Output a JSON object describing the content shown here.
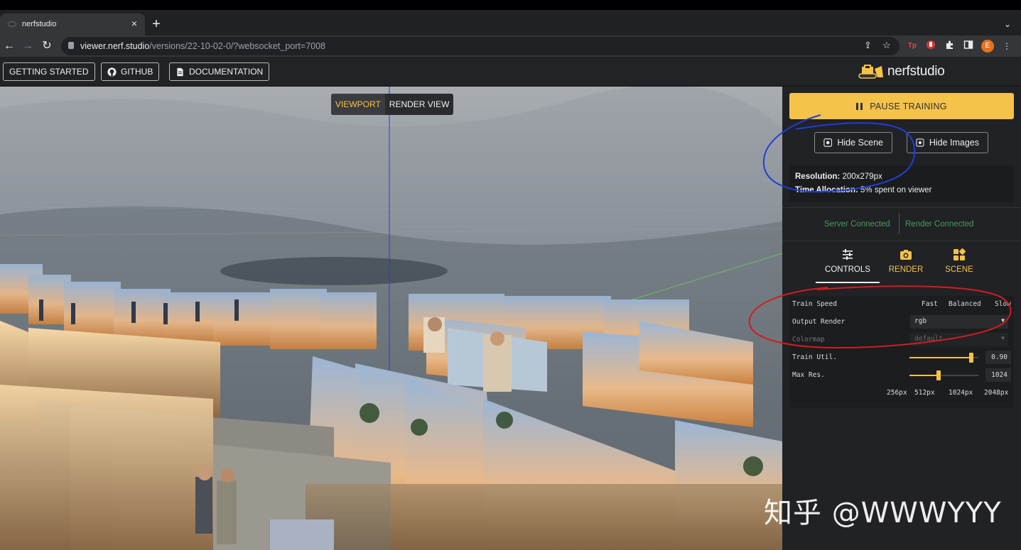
{
  "browser": {
    "tab_title": "nerfstudio",
    "tab_close": "×",
    "new_tab": "+",
    "tab_menu": "⌄",
    "url_host": "viewer.nerf.studio",
    "url_path": "/versions/22-10-02-0/?websocket_port=7008",
    "profile_initial": "E"
  },
  "header": {
    "buttons": [
      {
        "label": "GETTING STARTED"
      },
      {
        "label": "GITHUB"
      },
      {
        "label": "DOCUMENTATION"
      }
    ],
    "logo_text": "nerfstudio"
  },
  "viewport": {
    "tabs": [
      "VIEWPORT",
      "RENDER VIEW"
    ]
  },
  "panel": {
    "pause_label": "PAUSE TRAINING",
    "hide_scene": "Hide Scene",
    "hide_images": "Hide Images",
    "resolution_label": "Resolution:",
    "resolution_value": "200x279px",
    "time_label": "Time Allocation:",
    "time_value": "5% spent on viewer",
    "server_status": "Server Connected",
    "render_status": "Render Connected",
    "tabs": [
      {
        "label": "CONTROLS",
        "icon": "sliders-icon"
      },
      {
        "label": "RENDER",
        "icon": "camera-icon"
      },
      {
        "label": "SCENE",
        "icon": "widgets-icon"
      }
    ],
    "controls": {
      "train_speed_label": "Train Speed",
      "train_speed_options": [
        "Fast",
        "Balanced",
        "Slow"
      ],
      "output_render_label": "Output Render",
      "output_render_value": "rgb",
      "colormap_label": "Colormap",
      "colormap_value": "default",
      "train_util_label": "Train Util.",
      "train_util_value": "0.90",
      "train_util_fraction": 0.9,
      "max_res_label": "Max Res.",
      "max_res_value": "1024",
      "max_res_fraction": 0.42,
      "max_res_marks": [
        "256px",
        "512px",
        "1024px",
        "2048px"
      ]
    }
  },
  "watermark": "知乎 @WWWYYY",
  "colors": {
    "accent": "#f5c24a",
    "annotation_blue": "#1f3fd6",
    "annotation_red": "#d41c1c",
    "connected_green": "#4a9a5a"
  }
}
